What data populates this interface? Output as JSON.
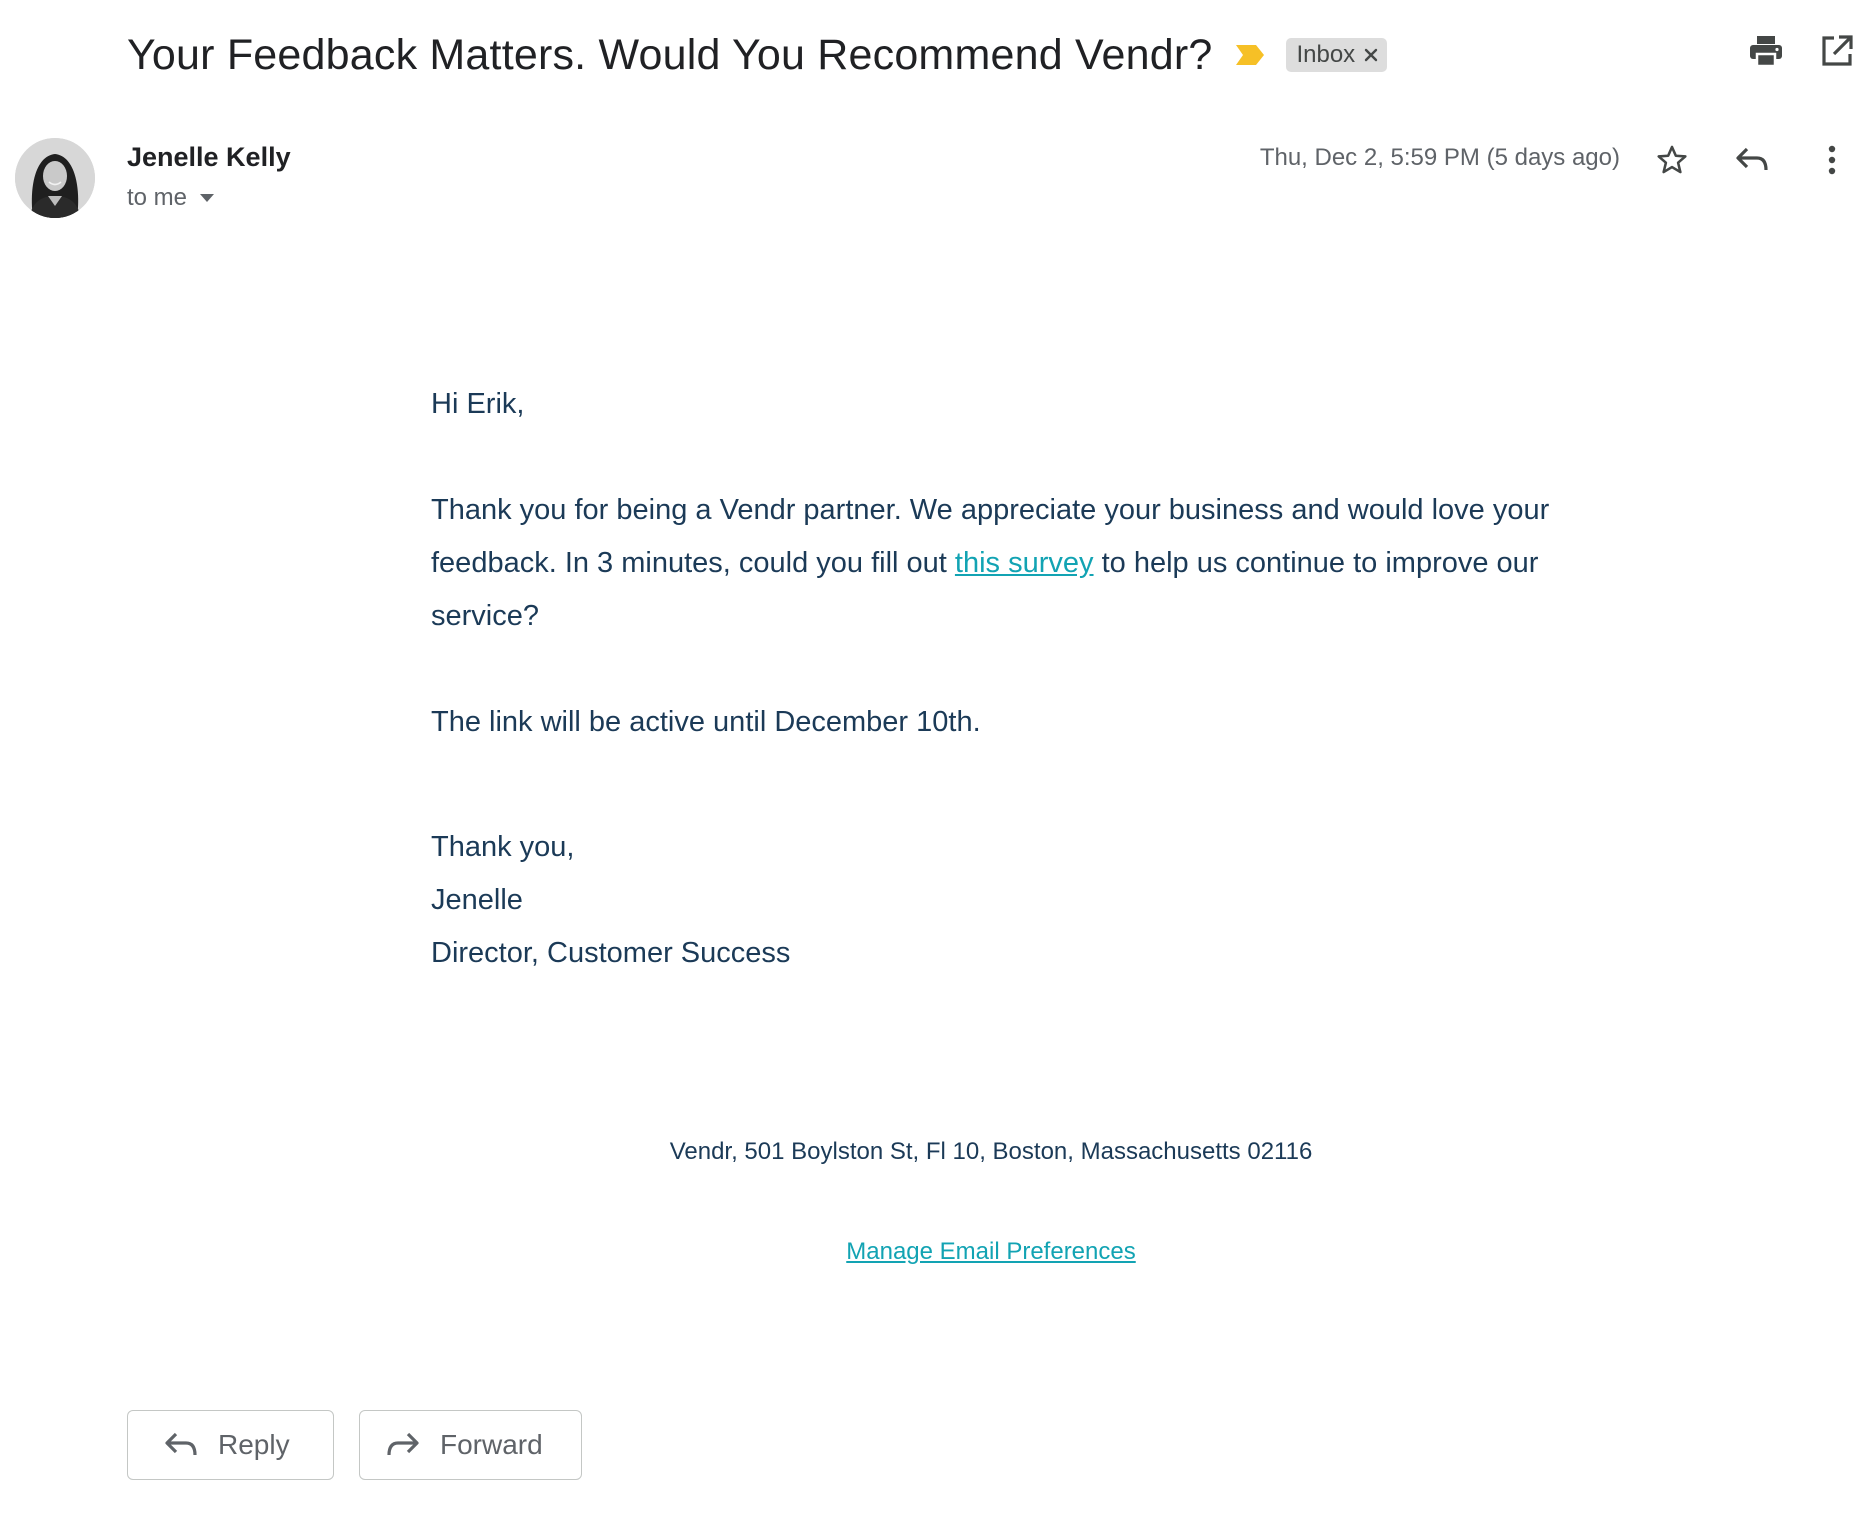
{
  "email": {
    "subject": "Your Feedback Matters. Would You Recommend Vendr?",
    "label": "Inbox",
    "sender_name": "Jenelle Kelly",
    "recipient": "to me",
    "date": "Thu, Dec 2, 5:59 PM (5 days ago)"
  },
  "message": {
    "greeting": "Hi Erik,",
    "para1_before": "Thank you for being a Vendr partner. We appreciate your business and would love your feedback. In 3 minutes, could you fill out ",
    "survey_link_text": "this survey",
    "para1_after": " to help us continue to improve our service?",
    "active_note": "The link will be active until December 10th.",
    "signoff": "Thank you,",
    "signature_name": "Jenelle",
    "signature_title": "Director, Customer Success",
    "footer_address": "Vendr, 501 Boylston St, Fl 10, Boston, Massachusetts 02116",
    "manage_link": "Manage Email Preferences"
  },
  "actions": {
    "reply_label": "Reply",
    "forward_label": "Forward"
  },
  "colors": {
    "importance_marker": "#f6c026",
    "body_text": "#1b3a57",
    "link": "#12a3b3",
    "label_chip_bg": "#dddddd"
  },
  "icons": {
    "importance": "importance-marker-icon",
    "chip_close": "close-icon",
    "print": "print-icon",
    "new_window": "open-in-new-window-icon",
    "expand_recipients": "chevron-down-icon",
    "star": "star-icon",
    "reply": "reply-icon",
    "more": "more-vert-icon",
    "forward": "forward-icon"
  }
}
